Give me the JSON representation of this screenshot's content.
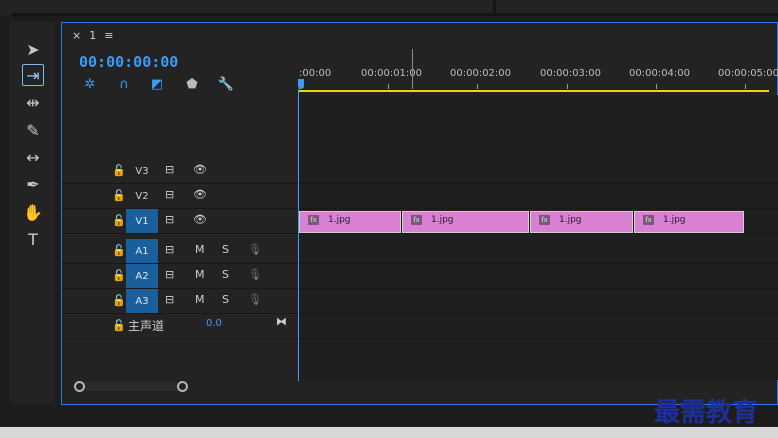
{
  "sequence": {
    "close": "×",
    "name": "1",
    "menu": "≡"
  },
  "timecode": "00:00:00:00",
  "ruler": {
    "labels": [
      ":00:00",
      "00:00:01:00",
      "00:00:02:00",
      "00:00:03:00",
      "00:00:04:00",
      "00:00:05:00"
    ]
  },
  "tools": [
    "selection-tool",
    "track-select-tool",
    "ripple-edit-tool",
    "razor-tool",
    "slip-tool",
    "pen-tool",
    "hand-tool",
    "type-tool"
  ],
  "tracks": {
    "video": [
      {
        "name": "V3"
      },
      {
        "name": "V2"
      },
      {
        "name": "V1",
        "active": true
      }
    ],
    "audio": [
      {
        "name": "A1",
        "m": "M",
        "s": "S"
      },
      {
        "name": "A2",
        "m": "M",
        "s": "S"
      },
      {
        "name": "A3",
        "m": "M",
        "s": "S"
      }
    ],
    "master": {
      "label": "主声道",
      "volume": "0.0"
    }
  },
  "clips": [
    {
      "name": "1.jpg",
      "fx": "fx"
    },
    {
      "name": "1.jpg",
      "fx": "fx"
    },
    {
      "name": "1.jpg",
      "fx": "fx"
    },
    {
      "name": "1.jpg",
      "fx": "fx"
    }
  ],
  "watermark": "最需教育",
  "colors": {
    "accent": "#3d9bf8",
    "clip": "#d97fd4",
    "work_area": "#e8d800"
  }
}
